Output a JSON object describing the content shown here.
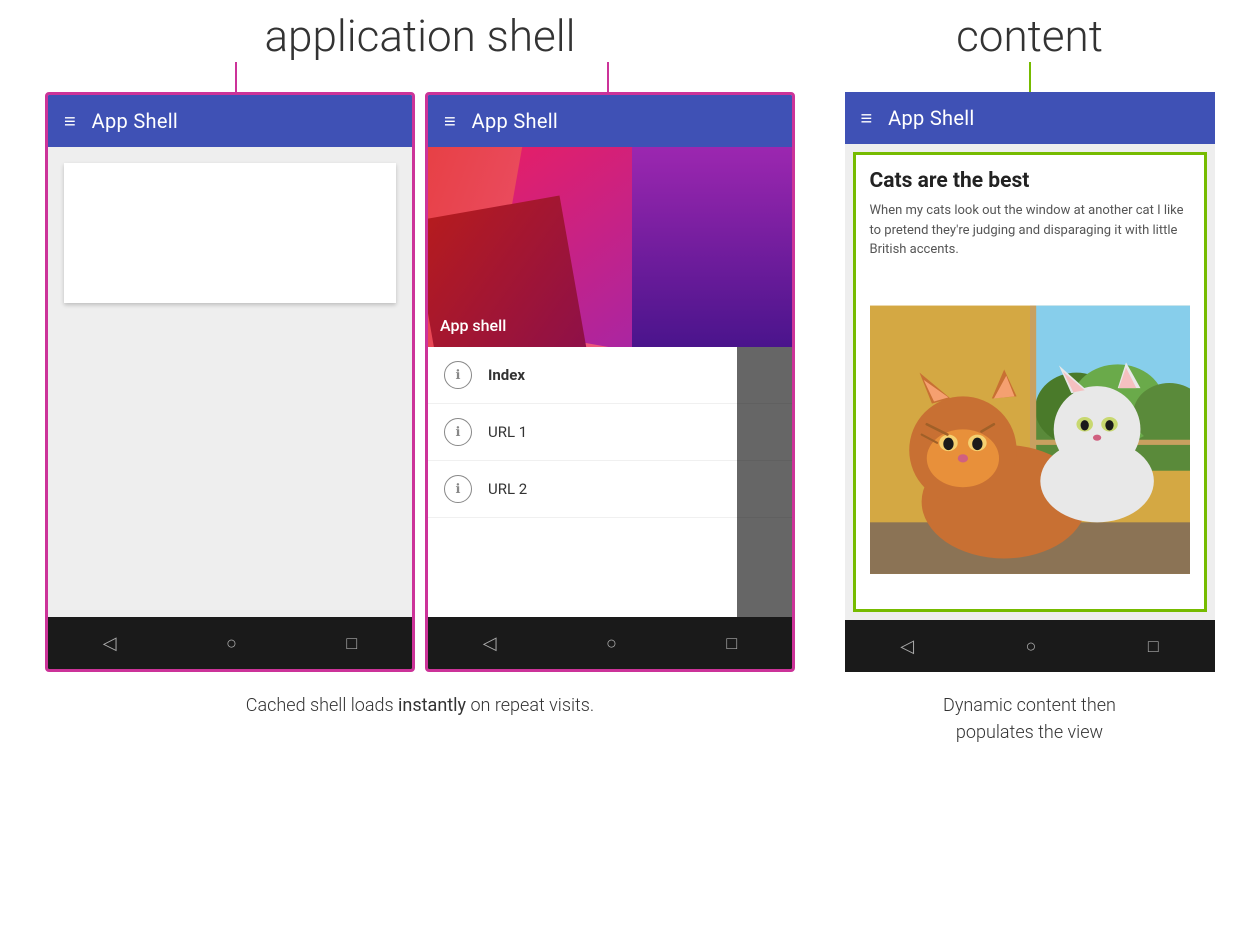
{
  "labels": {
    "app_shell_label": "application shell",
    "content_label": "content",
    "app_bar_title": "App Shell",
    "app_shell_drawer_label": "App shell",
    "drawer_items": [
      {
        "text": "Index",
        "bold": true
      },
      {
        "text": "URL 1",
        "bold": false
      },
      {
        "text": "URL 2",
        "bold": false
      }
    ],
    "article_title": "Cats are the best",
    "article_body": "When my cats look out the window at another cat I like to pretend they're judging and disparaging it with little British accents.",
    "caption_left": "Cached shell loads instantly on repeat visits.",
    "caption_left_bold": "instantly",
    "caption_right_line1": "Dynamic content then",
    "caption_right_line2": "populates the view",
    "nav_back": "◁",
    "nav_home": "○",
    "nav_square": "□",
    "hamburger": "≡"
  },
  "colors": {
    "app_bar": "#3f51b5",
    "border_pink": "#cc3399",
    "border_green": "#76bb00",
    "nav_bar": "#1a1a1a"
  }
}
